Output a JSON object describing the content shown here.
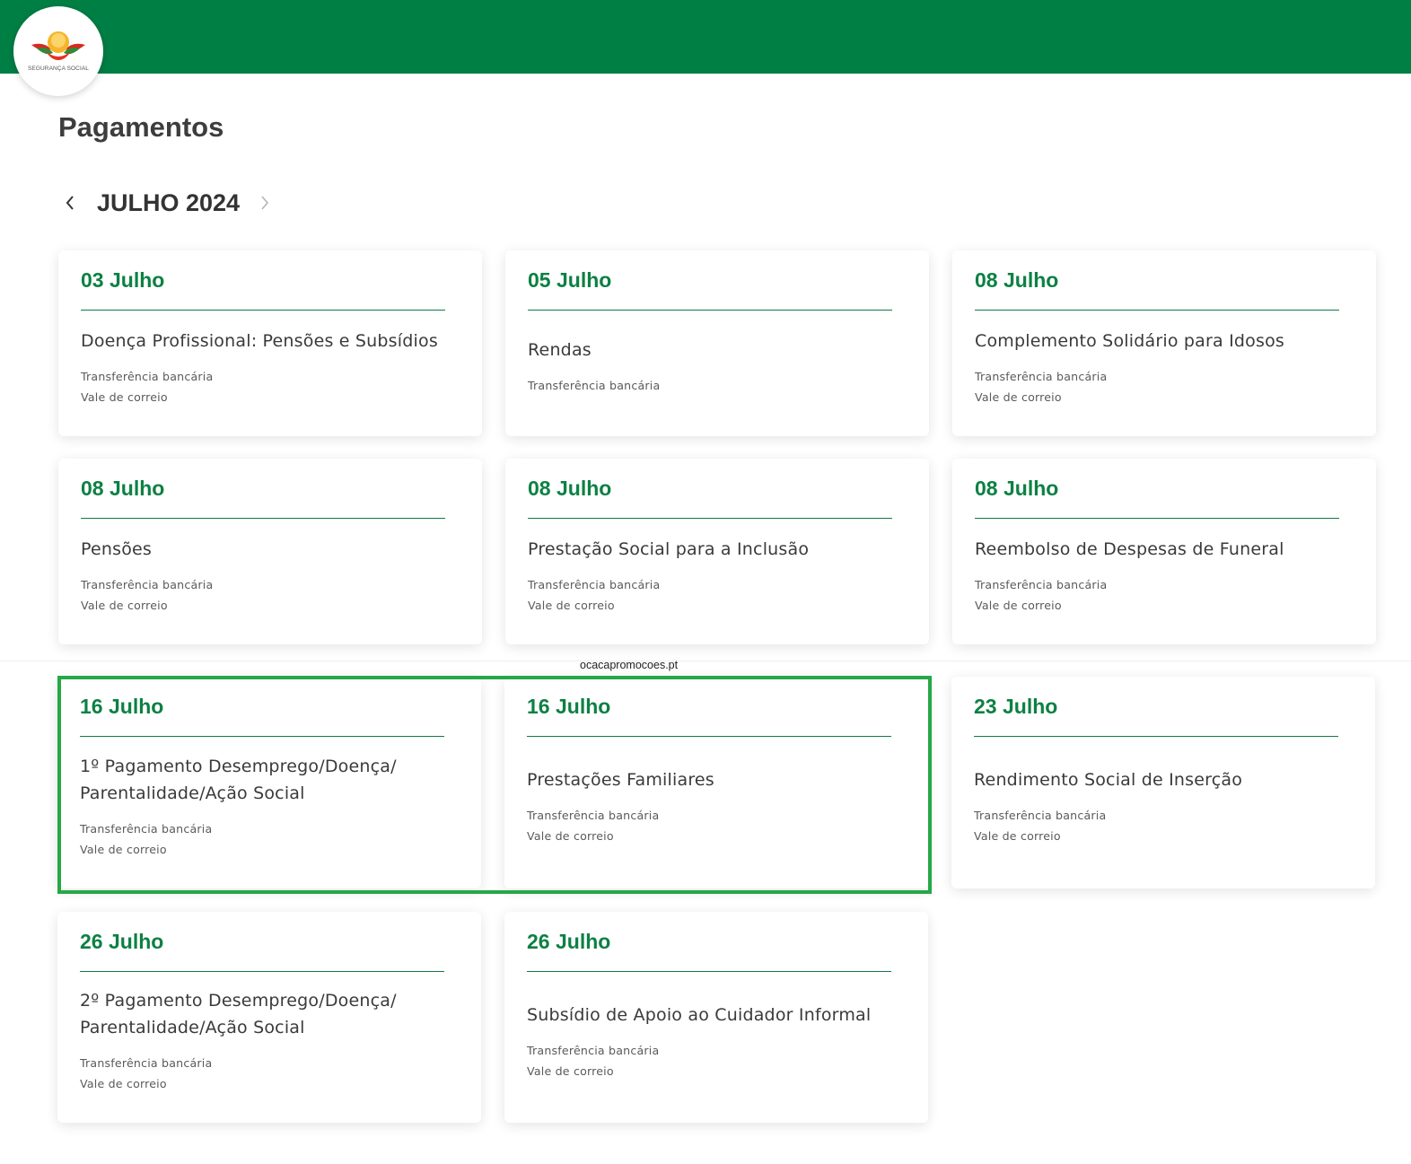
{
  "header": {
    "logo_text": "SEGURANÇA SOCIAL",
    "bar_color": "#007f45"
  },
  "page": {
    "title": "Pagamentos"
  },
  "month_nav": {
    "label": "JULHO 2024",
    "prev_icon": "chevron-left-icon",
    "next_icon": "chevron-right-icon"
  },
  "watermark": "ocacapromocoes.pt",
  "colors": {
    "accent_green": "#0d8044",
    "highlight_border": "#26a846"
  },
  "payments": [
    {
      "date": "03 Julho",
      "title": "Doença Profissional: Pensões e Subsídios",
      "methods": [
        "Transferência bancária",
        "Vale de correio"
      ]
    },
    {
      "date": "05 Julho",
      "title": "Rendas",
      "methods": [
        "Transferência bancária"
      ]
    },
    {
      "date": "08 Julho",
      "title": "Complemento Solidário para Idosos",
      "methods": [
        "Transferência bancária",
        "Vale de correio"
      ]
    },
    {
      "date": "08 Julho",
      "title": "Pensões",
      "methods": [
        "Transferência bancária",
        "Vale de correio"
      ]
    },
    {
      "date": "08 Julho",
      "title": "Prestação Social para a Inclusão",
      "methods": [
        "Transferência bancária",
        "Vale de correio"
      ]
    },
    {
      "date": "08 Julho",
      "title": "Reembolso de Despesas de Funeral",
      "methods": [
        "Transferência bancária",
        "Vale de correio"
      ]
    },
    {
      "date": "16 Julho",
      "title": "1º Pagamento Desemprego/Doença/\nParentalidade/Ação Social",
      "methods": [
        "Transferência bancária",
        "Vale de correio"
      ]
    },
    {
      "date": "16 Julho",
      "title": "Prestações Familiares",
      "methods": [
        "Transferência bancária",
        "Vale de correio"
      ]
    },
    {
      "date": "23 Julho",
      "title": "Rendimento Social de Inserção",
      "methods": [
        "Transferência bancária",
        "Vale de correio"
      ]
    },
    {
      "date": "26 Julho",
      "title": "2º Pagamento Desemprego/Doença/\nParentalidade/Ação Social",
      "methods": [
        "Transferência bancária",
        "Vale de correio"
      ]
    },
    {
      "date": "26 Julho",
      "title": "Subsídio de Apoio ao Cuidador Informal",
      "methods": [
        "Transferência bancária",
        "Vale de correio"
      ]
    }
  ]
}
